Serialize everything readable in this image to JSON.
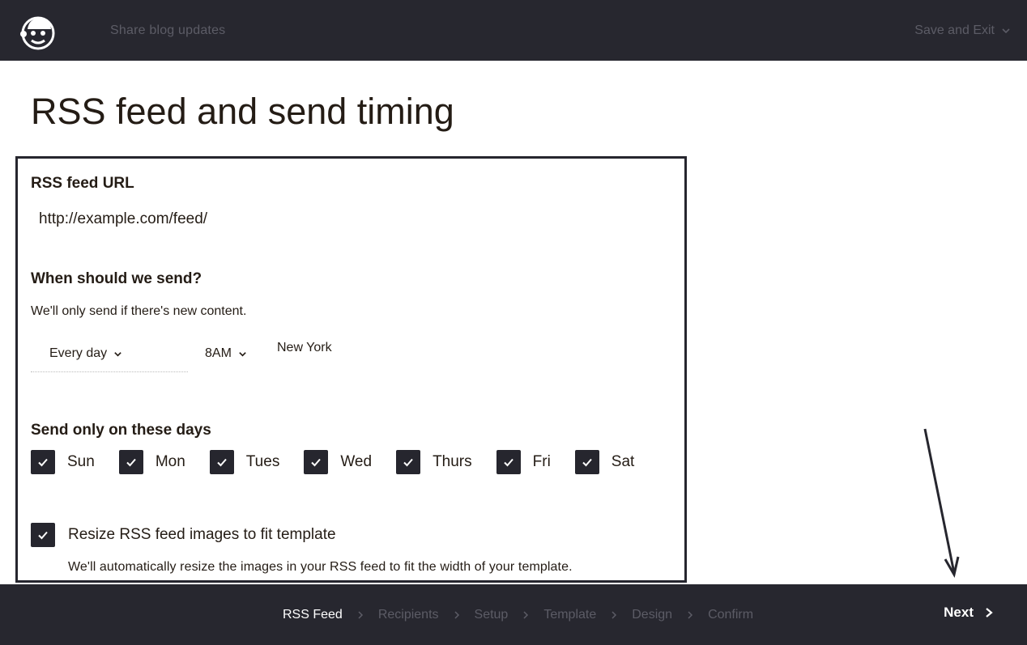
{
  "header": {
    "logo": "mailchimp-freddie-logo",
    "campaign_name": "Share blog updates",
    "save_exit_label": "Save and Exit"
  },
  "page": {
    "title": "RSS feed and send timing"
  },
  "form": {
    "rss_url_label": "RSS feed URL",
    "rss_url_value": "http://example.com/feed/",
    "when_label": "When should we send?",
    "when_hint": "We'll only send if there's new content.",
    "frequency_value": "Every day",
    "time_value": "8AM",
    "timezone": "New York",
    "days_label": "Send only on these days",
    "days": [
      {
        "label": "Sun",
        "checked": true
      },
      {
        "label": "Mon",
        "checked": true
      },
      {
        "label": "Tues",
        "checked": true
      },
      {
        "label": "Wed",
        "checked": true
      },
      {
        "label": "Thurs",
        "checked": true
      },
      {
        "label": "Fri",
        "checked": true
      },
      {
        "label": "Sat",
        "checked": true
      }
    ],
    "resize_label": "Resize RSS feed images to fit template",
    "resize_checked": true,
    "resize_help": "We'll automatically resize the images in your RSS feed to fit the width of your template."
  },
  "footer": {
    "steps": [
      {
        "label": "RSS Feed",
        "active": true
      },
      {
        "label": "Recipients",
        "active": false
      },
      {
        "label": "Setup",
        "active": false
      },
      {
        "label": "Template",
        "active": false
      },
      {
        "label": "Design",
        "active": false
      },
      {
        "label": "Confirm",
        "active": false
      }
    ],
    "next_label": "Next"
  },
  "colors": {
    "bar_bg": "#27272f",
    "text_dark": "#241c15",
    "muted": "#5c5c66",
    "checkbox": "#26262e"
  }
}
